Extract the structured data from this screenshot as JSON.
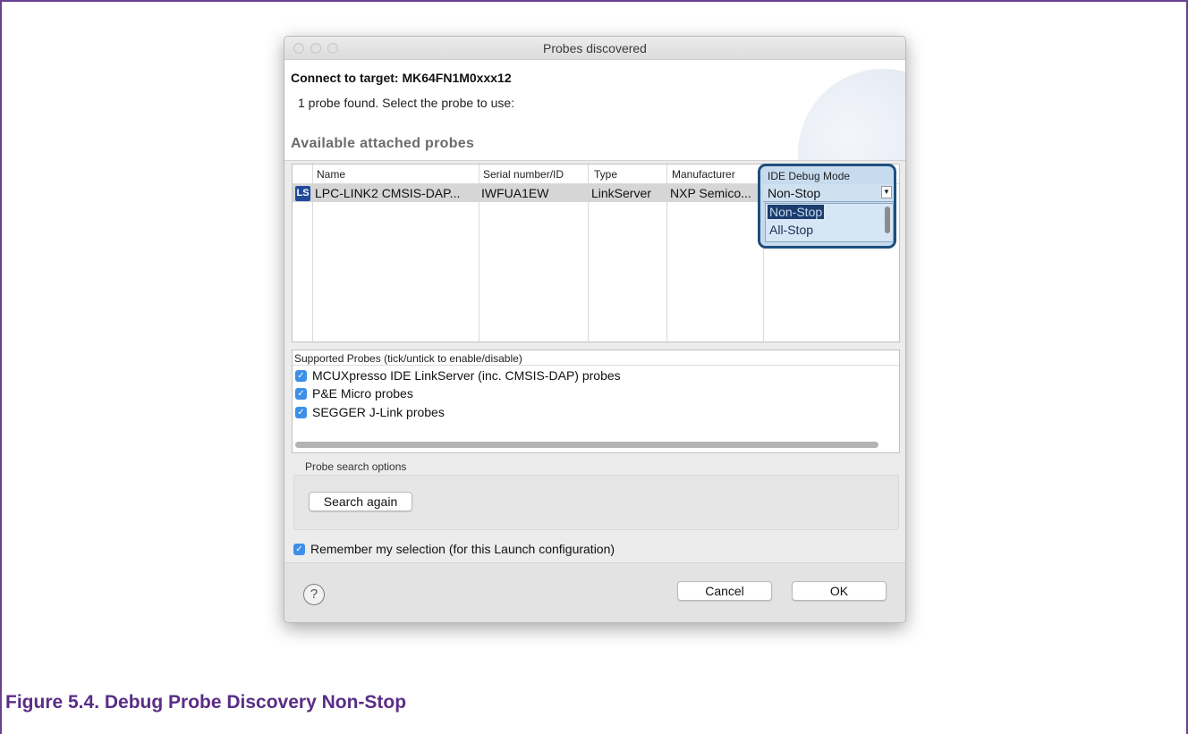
{
  "dialog": {
    "title": "Probes discovered",
    "connect_label": "Connect to target: MK64FN1M0xxx12",
    "found_text": "1 probe found. Select the probe to use:",
    "section_title": "Available attached probes"
  },
  "table": {
    "headers": [
      "Name",
      "Serial number/ID",
      "Type",
      "Manufacturer",
      "IDE Debug Mode"
    ],
    "rows": [
      {
        "icon": "LS",
        "name": "LPC-LINK2 CMSIS-DAP...",
        "serial": "IWFUA1EW",
        "type": "LinkServer",
        "manufacturer": "NXP Semico...",
        "debug_mode": "Non-Stop"
      }
    ],
    "debug_mode_options": [
      "Non-Stop",
      "All-Stop"
    ],
    "highlight_color": "#1e4f7f"
  },
  "supported": {
    "title": "Supported Probes (tick/untick to enable/disable)",
    "items": [
      {
        "label": "MCUXpresso IDE LinkServer (inc. CMSIS-DAP) probes",
        "checked": true
      },
      {
        "label": "P&E Micro probes",
        "checked": true
      },
      {
        "label": "SEGGER J-Link probes",
        "checked": true
      }
    ]
  },
  "search": {
    "section_label": "Probe search options",
    "button_label": "Search again"
  },
  "remember": {
    "label": "Remember my selection (for this Launch configuration)",
    "checked": true
  },
  "footer": {
    "help_icon": "?",
    "cancel_label": "Cancel",
    "ok_label": "OK"
  },
  "caption": "Figure 5.4. Debug Probe Discovery Non-Stop",
  "colors": {
    "caption": "#5a2d86",
    "checkbox": "#3d8fe8",
    "ls_icon": "#1f4a9a"
  }
}
